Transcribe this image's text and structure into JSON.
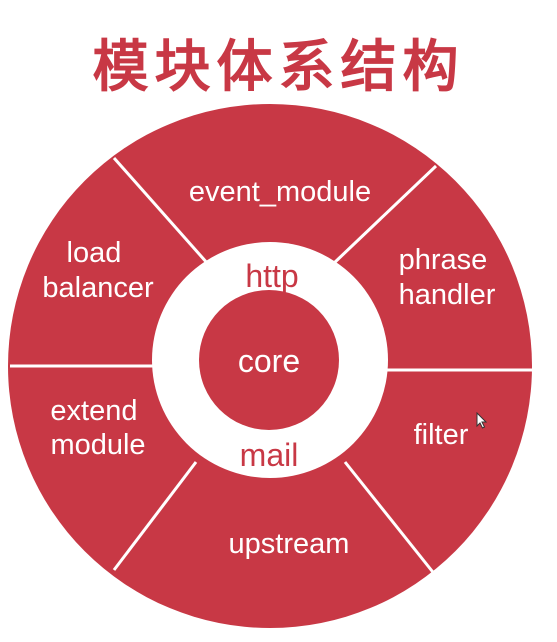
{
  "title": "模块体系结构",
  "colors": {
    "accent": "#c83845",
    "background": "#ffffff",
    "divider": "#ffffff"
  },
  "diagram": {
    "segments": [
      {
        "id": "event_module",
        "lines": [
          "event_module"
        ]
      },
      {
        "id": "phrase_handler",
        "lines": [
          "phrase",
          "handler"
        ]
      },
      {
        "id": "filter",
        "lines": [
          "filter"
        ]
      },
      {
        "id": "upstream",
        "lines": [
          "upstream"
        ]
      },
      {
        "id": "extend_module",
        "lines": [
          "extend",
          "module"
        ]
      },
      {
        "id": "load_balancer",
        "lines": [
          "load",
          "balancer"
        ]
      }
    ],
    "inner_ring": {
      "top": "http",
      "bottom": "mail"
    },
    "center": "core"
  }
}
